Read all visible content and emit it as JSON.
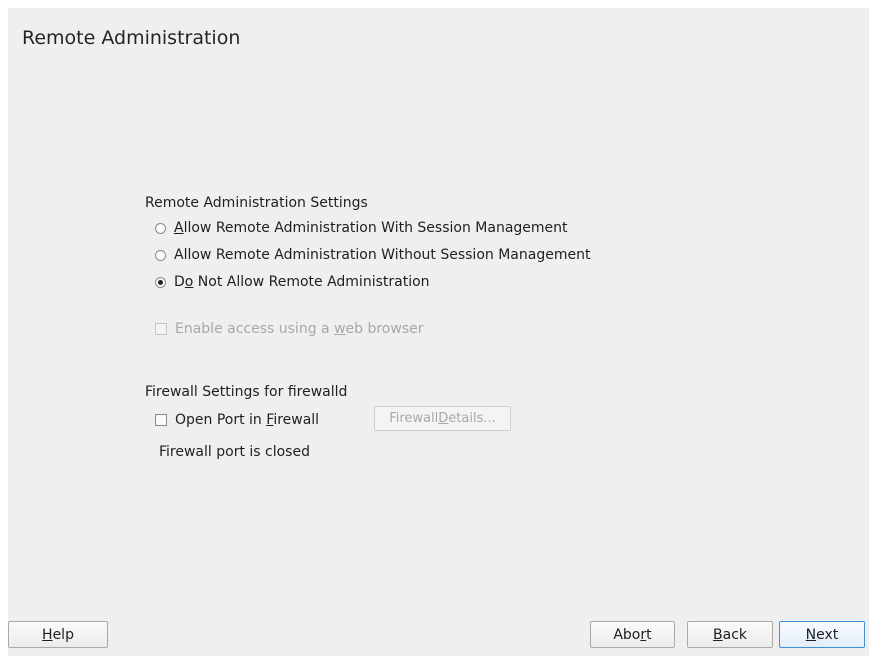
{
  "page": {
    "title": "Remote Administration"
  },
  "remote_settings": {
    "group_label": "Remote Administration Settings",
    "options": [
      {
        "pre": "",
        "mnemonic": "A",
        "post": "llow Remote Administration With Session Management",
        "checked": false
      },
      {
        "pre": "",
        "mnemonic": "",
        "post": "Allow Remote Administration Without Session Management",
        "checked": false
      },
      {
        "pre": "D",
        "mnemonic": "o",
        "post": " Not Allow Remote Administration",
        "checked": true
      }
    ],
    "web_browser": {
      "pre": "Enable access using a ",
      "mnemonic": "w",
      "post": "eb browser",
      "checked": false,
      "enabled": false
    }
  },
  "firewall": {
    "group_label": "Firewall Settings for firewalld",
    "open_port": {
      "pre": "Open Port in ",
      "mnemonic": "F",
      "post": "irewall",
      "checked": false
    },
    "details_button": {
      "pre": "Firewall ",
      "mnemonic": "D",
      "post": "etails...",
      "enabled": false
    },
    "status": "Firewall port is closed"
  },
  "buttons": {
    "help": {
      "pre": "",
      "mnemonic": "H",
      "post": "elp"
    },
    "abort": {
      "pre": "Abo",
      "mnemonic": "r",
      "post": "t"
    },
    "back": {
      "pre": "",
      "mnemonic": "B",
      "post": "ack"
    },
    "next": {
      "pre": "",
      "mnemonic": "N",
      "post": "ext"
    }
  }
}
